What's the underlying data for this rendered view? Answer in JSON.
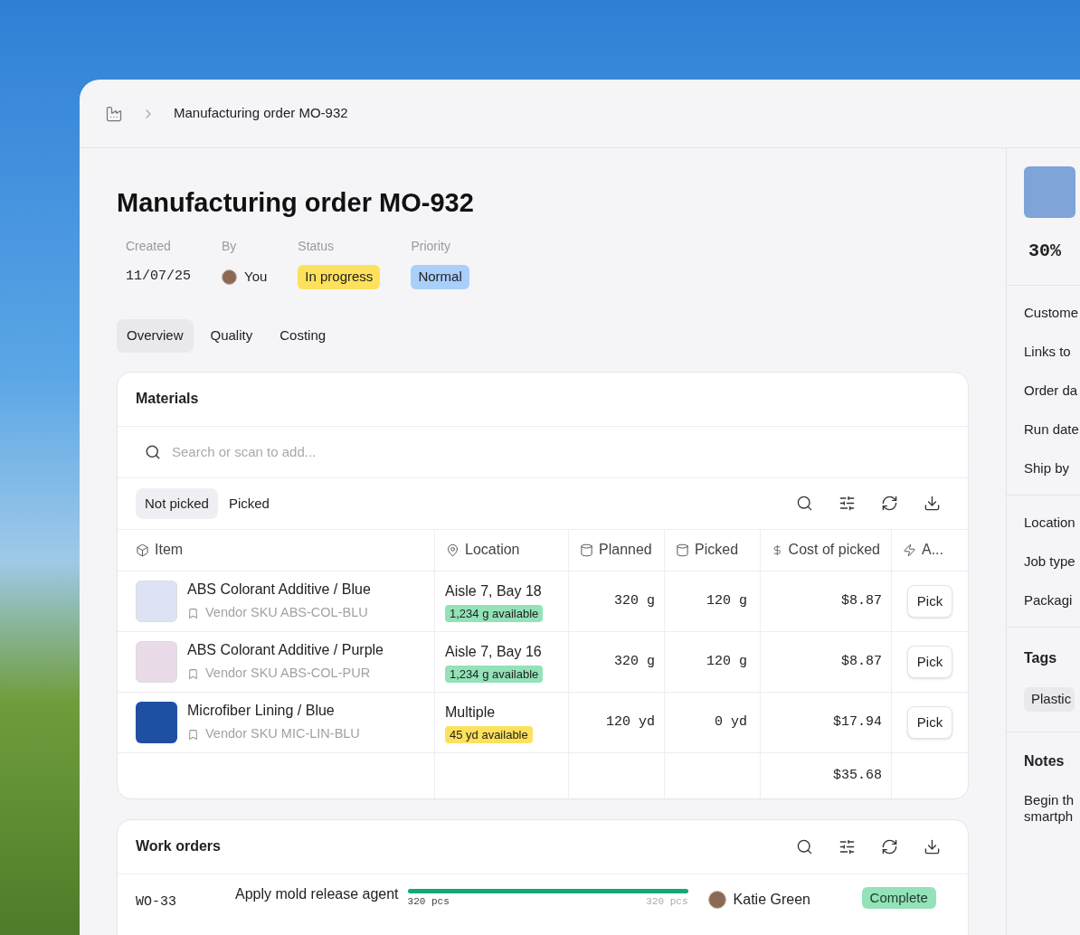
{
  "breadcrumb": {
    "title": "Manufacturing order MO-932"
  },
  "page": {
    "title": "Manufacturing order MO-932",
    "meta": [
      {
        "label": "Created",
        "value": "11/07/25",
        "kind": "date"
      },
      {
        "label": "By",
        "value": "You",
        "kind": "user"
      },
      {
        "label": "Status",
        "value": "In progress",
        "kind": "badge",
        "color": "#fde15c"
      },
      {
        "label": "Priority",
        "value": "Normal",
        "kind": "badge",
        "color": "#a9cffb"
      }
    ]
  },
  "tabs": [
    {
      "label": "Overview",
      "selected": true
    },
    {
      "label": "Quality",
      "selected": false
    },
    {
      "label": "Costing",
      "selected": false
    }
  ],
  "materials": {
    "title": "Materials",
    "search": {
      "placeholder": "Search or scan to add..."
    },
    "filters": [
      {
        "label": "Not picked",
        "selected": true
      },
      {
        "label": "Picked",
        "selected": false
      }
    ],
    "columns": [
      "Item",
      "Location",
      "Planned",
      "Picked",
      "Cost of picked",
      "A..."
    ],
    "rows": [
      {
        "name": "ABS Colorant Additive / Blue",
        "sku": "Vendor SKU ABS-COL-BLU",
        "location": "Aisle 7, Bay 18",
        "availability": "1,234 g available",
        "color": "#93e2b8",
        "planned": "320 g",
        "picked": "120 g",
        "cost": "$8.87",
        "action": "Pick"
      },
      {
        "name": "ABS Colorant Additive / Purple",
        "sku": "Vendor SKU ABS-COL-PUR",
        "location": "Aisle 7, Bay 16",
        "availability": "1,234 g available",
        "color": "#93e2b8",
        "planned": "320 g",
        "picked": "120 g",
        "cost": "$8.87",
        "action": "Pick"
      },
      {
        "name": "Microfiber Lining / Blue",
        "sku": "Vendor SKU MIC-LIN-BLU",
        "location": "Multiple",
        "availability": "45 yd available",
        "color": "#fde15c",
        "planned": "120 yd",
        "picked": "0 yd",
        "cost": "$17.94",
        "action": "Pick"
      }
    ],
    "total": "$35.68"
  },
  "work_orders": {
    "title": "Work orders",
    "rows": [
      {
        "id": "WO-33",
        "name": "Apply mold release agent",
        "level": 1,
        "done": "320 pcs",
        "target": "320 pcs",
        "assignee": "Katie Green",
        "status": "Complete"
      }
    ]
  },
  "sidebar": {
    "progress": "30%",
    "fields": [
      "Custome",
      "Links to",
      "Order da",
      "Run date",
      "Ship by"
    ],
    "details": [
      "Location",
      "Job type",
      "Packagi"
    ],
    "tags_title": "Tags",
    "tags": [
      "Plastic"
    ],
    "notes_title": "Notes",
    "notes": [
      "Begin th",
      "smartph"
    ]
  }
}
